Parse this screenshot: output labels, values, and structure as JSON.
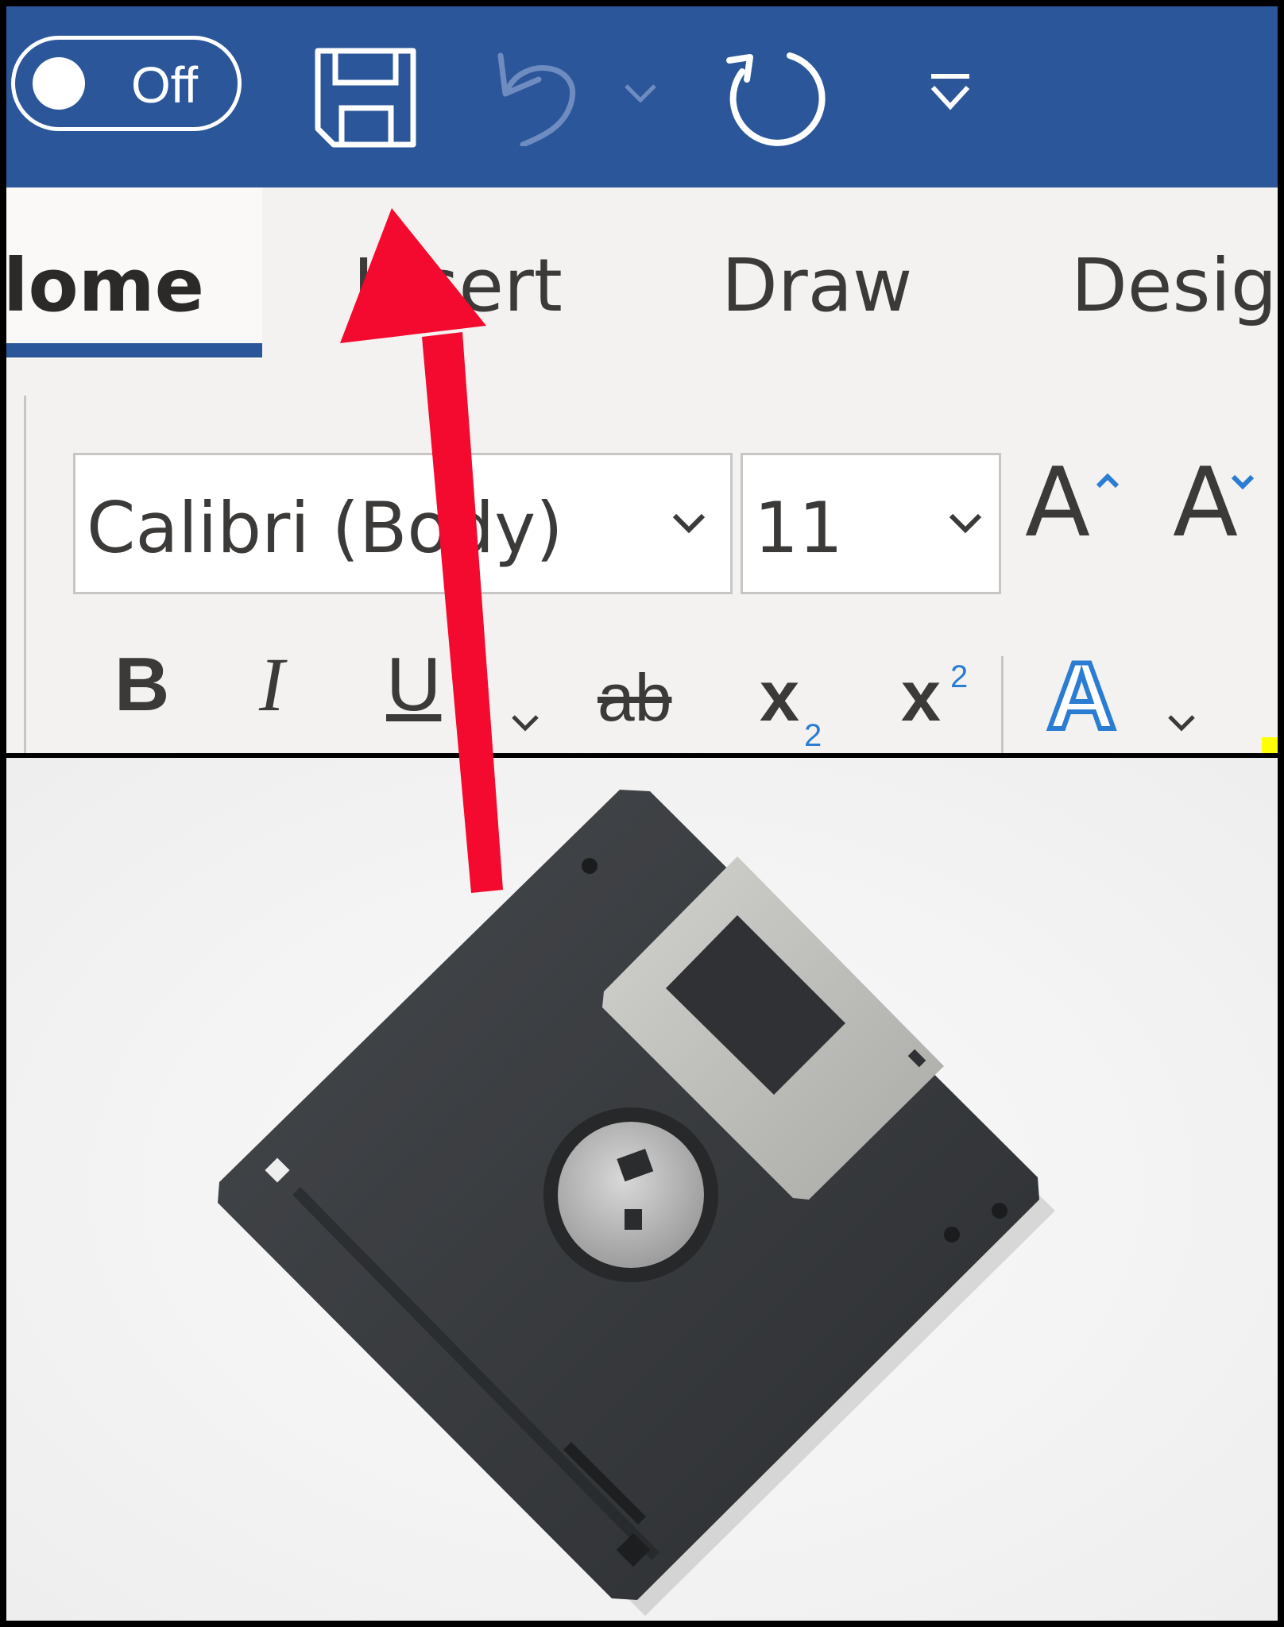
{
  "titlebar": {
    "autosave_label": "Off",
    "icons": [
      "save-icon",
      "undo-icon",
      "undo-dropdown-icon",
      "redo-icon",
      "customize-toolbar-icon"
    ],
    "color": "#2b579a"
  },
  "tabs": [
    {
      "label": "Home",
      "visible_text": "lome",
      "active": true
    },
    {
      "label": "Insert",
      "visible_text": "Insert"
    },
    {
      "label": "Draw",
      "visible_text": "Draw"
    },
    {
      "label": "Design",
      "visible_text": "Design"
    }
  ],
  "ribbon": {
    "font_name": "Calibri (Body)",
    "font_size": "11",
    "grow_font": "A",
    "shrink_font": "A",
    "bold": "B",
    "italic": "I",
    "underline": "U",
    "strikethrough": "ab",
    "subscript": "x",
    "subscript_mark": "2",
    "superscript": "x",
    "superscript_mark": "2",
    "text_effects": "A"
  },
  "annotation": {
    "arrow_color": "#f30a2e",
    "description_icon": "save-icon"
  },
  "photo": {
    "subject": "floppy-disk"
  }
}
